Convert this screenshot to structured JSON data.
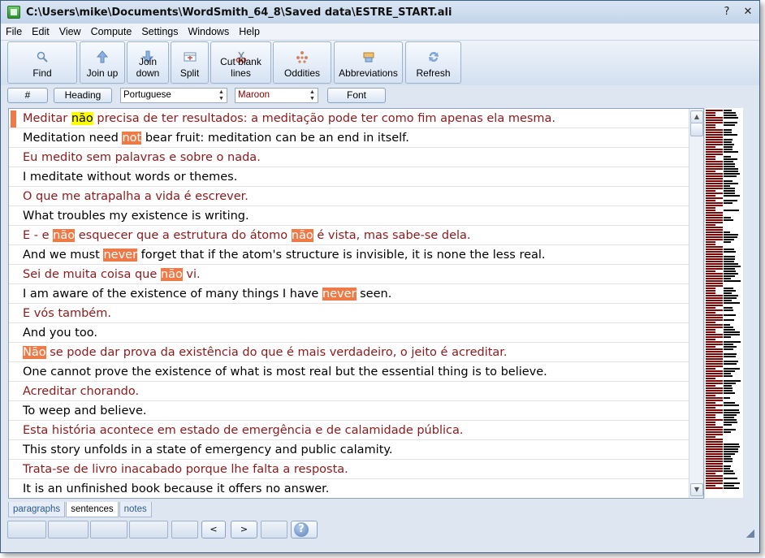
{
  "window": {
    "title": "C:\\Users\\mike\\Documents\\WordSmith_64_8\\Saved data\\ESTRE_START.ali"
  },
  "window_buttons": {
    "help": "?",
    "close": "✕"
  },
  "menu": [
    "File",
    "Edit",
    "View",
    "Compute",
    "Settings",
    "Windows",
    "Help"
  ],
  "toolbar": [
    {
      "label": "Find",
      "icon": "magnifier-icon"
    },
    {
      "label": "Join up",
      "icon": "arrow-up-icon"
    },
    {
      "label": "Join down",
      "icon": "arrow-down-icon"
    },
    {
      "label": "Split",
      "icon": "split-icon"
    },
    {
      "label": "Cut blank lines",
      "icon": "scissors-icon"
    },
    {
      "label": "Oddities",
      "icon": "oddities-icon"
    },
    {
      "label": "Abbreviations",
      "icon": "abbreviations-icon"
    },
    {
      "label": "Refresh",
      "icon": "refresh-icon"
    }
  ],
  "subbar": {
    "hash_label": "#",
    "heading_label": "Heading",
    "language_value": "Portuguese",
    "color_value": "Maroon",
    "font_label": "Font"
  },
  "rows": [
    {
      "lang": "pt",
      "selected": true,
      "segments": [
        {
          "t": "Meditar "
        },
        {
          "t": "não",
          "h": "yellow"
        },
        {
          "t": " precisa de ter resultados: a meditação pode ter como fim apenas ela mesma."
        }
      ]
    },
    {
      "lang": "en",
      "segments": [
        {
          "t": "Meditation need "
        },
        {
          "t": "not",
          "h": "orange"
        },
        {
          "t": " bear fruit: meditation can be an end in itself."
        }
      ]
    },
    {
      "lang": "pt",
      "segments": [
        {
          "t": "Eu medito sem palavras e sobre o nada."
        }
      ]
    },
    {
      "lang": "en",
      "segments": [
        {
          "t": "I meditate without words or themes."
        }
      ]
    },
    {
      "lang": "pt",
      "segments": [
        {
          "t": "O que me atrapalha a vida é escrever."
        }
      ]
    },
    {
      "lang": "en",
      "segments": [
        {
          "t": "What troubles my existence is writing."
        }
      ]
    },
    {
      "lang": "pt",
      "segments": [
        {
          "t": "E - e "
        },
        {
          "t": "não",
          "h": "orange"
        },
        {
          "t": " esquecer que a estrutura do átomo "
        },
        {
          "t": "não",
          "h": "orange"
        },
        {
          "t": " é vista, mas sabe-se dela."
        }
      ]
    },
    {
      "lang": "en",
      "segments": [
        {
          "t": "And we must "
        },
        {
          "t": "never",
          "h": "orange"
        },
        {
          "t": " forget that if the atom's structure is invisible, it is none the less real."
        }
      ]
    },
    {
      "lang": "pt",
      "segments": [
        {
          "t": "Sei de muita coisa que "
        },
        {
          "t": "não",
          "h": "orange"
        },
        {
          "t": " vi."
        }
      ]
    },
    {
      "lang": "en",
      "segments": [
        {
          "t": "I am aware of the existence of many things I have "
        },
        {
          "t": "never",
          "h": "orange"
        },
        {
          "t": " seen."
        }
      ]
    },
    {
      "lang": "pt",
      "segments": [
        {
          "t": "E vós também."
        }
      ]
    },
    {
      "lang": "en",
      "segments": [
        {
          "t": "And you too."
        }
      ]
    },
    {
      "lang": "pt",
      "segments": [
        {
          "t": "Não",
          "h": "orange"
        },
        {
          "t": " se pode dar prova da existência do que é mais verdadeiro, o jeito é acreditar."
        }
      ]
    },
    {
      "lang": "en",
      "segments": [
        {
          "t": "One cannot prove the existence of what is most real but the essential thing is to believe."
        }
      ]
    },
    {
      "lang": "pt",
      "segments": [
        {
          "t": "Acreditar chorando."
        }
      ]
    },
    {
      "lang": "en",
      "segments": [
        {
          "t": "To weep and believe."
        }
      ]
    },
    {
      "lang": "pt",
      "segments": [
        {
          "t": "Esta história acontece em estado de emergência e de calamidade pública."
        }
      ]
    },
    {
      "lang": "en",
      "segments": [
        {
          "t": "This story unfolds in a state of emergency and public calamity."
        }
      ]
    },
    {
      "lang": "pt",
      "segments": [
        {
          "t": "Trata-se de livro inacabado porque lhe falta a resposta."
        }
      ]
    },
    {
      "lang": "en",
      "segments": [
        {
          "t": "It is an unfinished book because it offers no answer."
        }
      ]
    }
  ],
  "tabs": [
    {
      "label": "paragraphs"
    },
    {
      "label": "sentences",
      "active": true
    },
    {
      "label": "notes"
    }
  ],
  "status": {
    "prev": "<",
    "next": ">",
    "help": "?"
  },
  "colors": {
    "pt_text": "#8b1a1a",
    "highlight": "#ee7a47",
    "search_highlight": "#ffff00",
    "barcode_maroon": "#800000",
    "barcode_black": "#000000"
  }
}
